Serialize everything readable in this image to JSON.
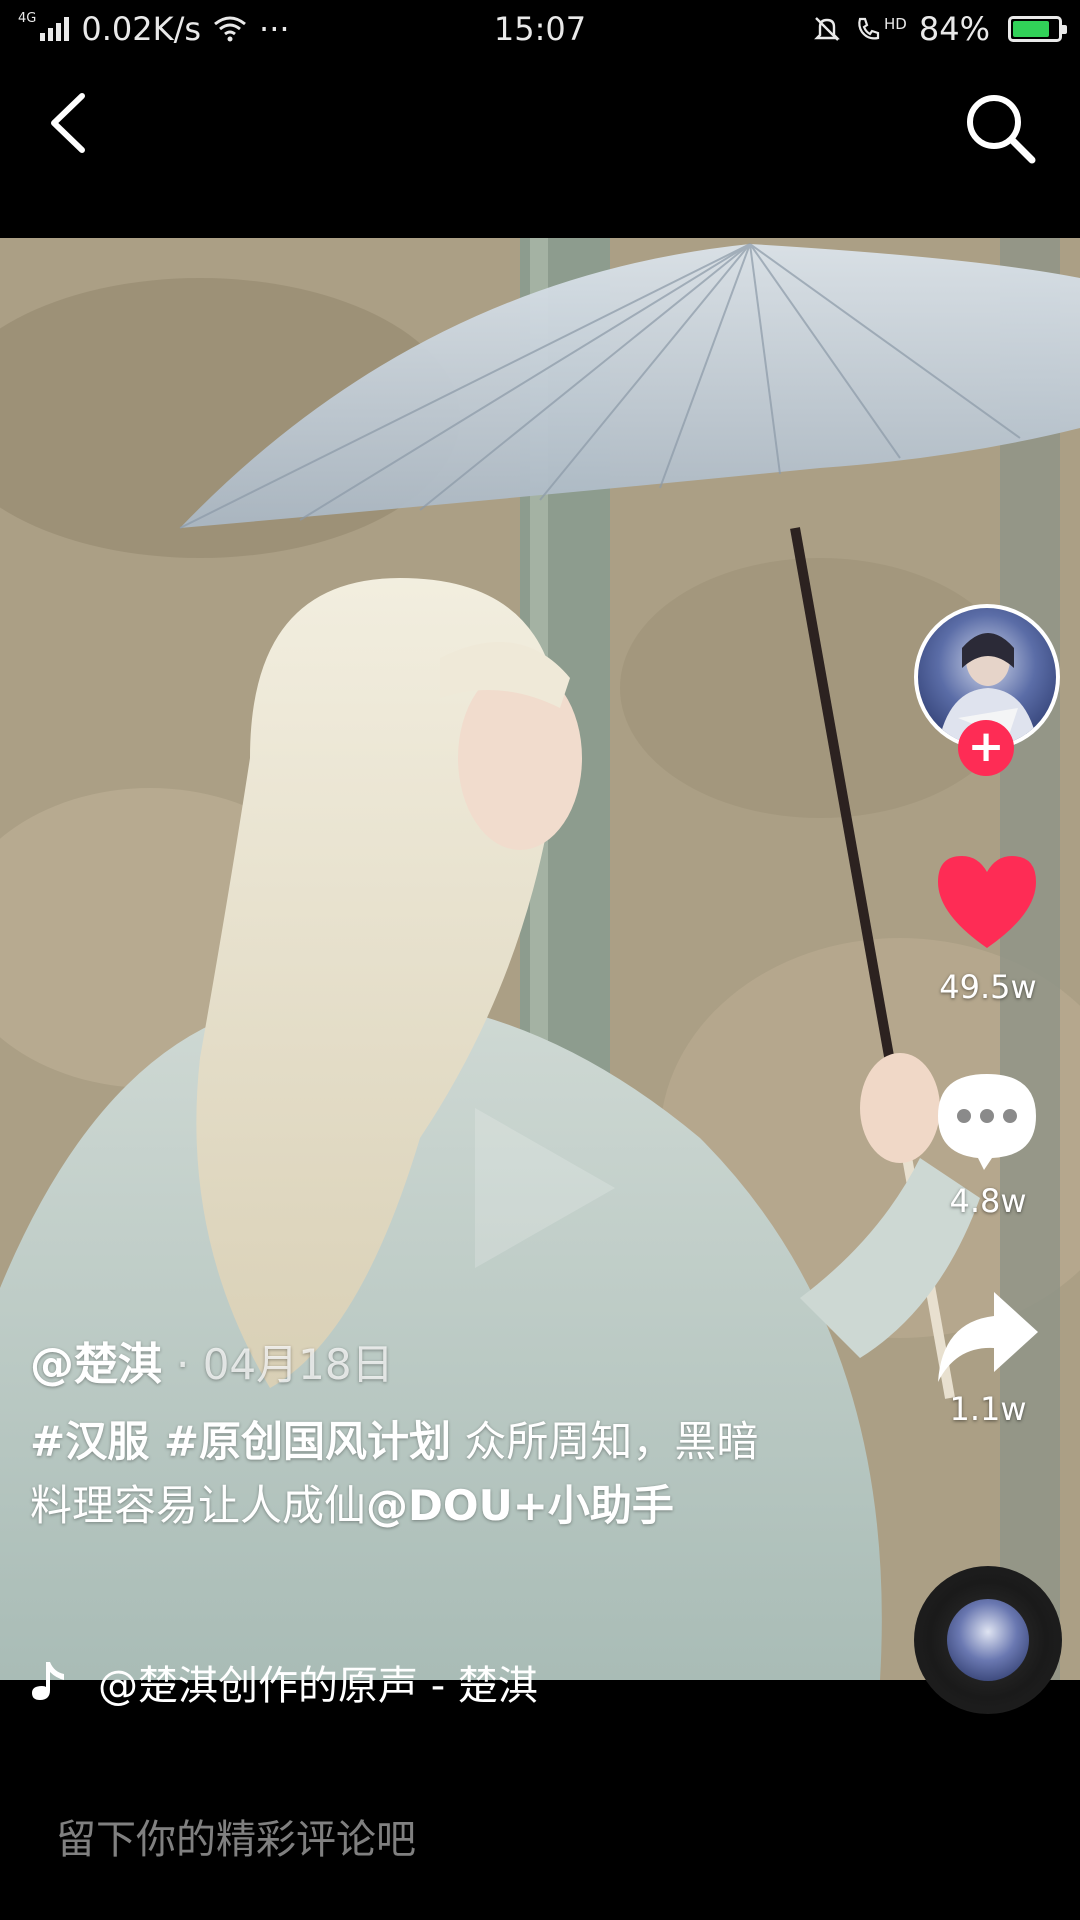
{
  "status_bar": {
    "network": "4G",
    "speed": "0.02K/s",
    "more": "···",
    "time": "15:07",
    "hd": "HD",
    "battery": "84%",
    "battery_level": 0.84
  },
  "video": {
    "author": "@楚淇",
    "date": "· 04月18日",
    "caption_tags": "#汉服 #原创国风计划",
    "caption_text": " 众所周知，黑暗料理容易让人成仙",
    "mention": "@DOU+小助手",
    "music": "@楚淇创作的原声 - 楚淇"
  },
  "actions": {
    "likes": "49.5w",
    "comments": "4.8w",
    "shares": "1.1w",
    "follow": "+"
  },
  "comment_bar": {
    "placeholder": "留下你的精彩评论吧"
  },
  "colors": {
    "like": "#fe2c55",
    "follow": "#fe2c55",
    "battery": "#31d158"
  }
}
